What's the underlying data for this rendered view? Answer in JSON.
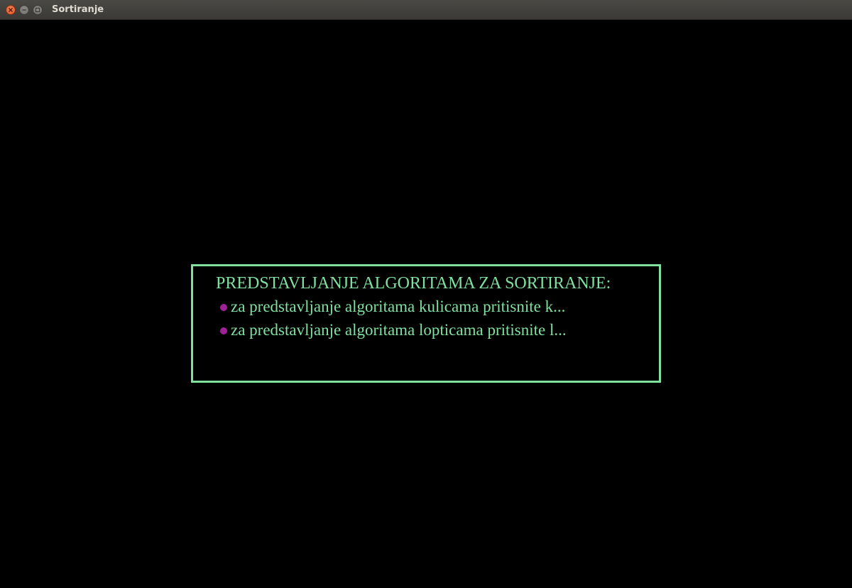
{
  "window": {
    "title": "Sortiranje"
  },
  "menu": {
    "heading": "PREDSTAVLJANJE ALGORITAMA ZA SORTIRANJE:",
    "items": [
      {
        "label": "za predstavljanje algoritama kulicama pritisnite k..."
      },
      {
        "label": "za predstavljanje algoritama lopticama pritisnite l..."
      }
    ]
  },
  "colors": {
    "background": "#000000",
    "text": "#7fe0a0",
    "border": "#7fe0a0",
    "bullet": "#a0209a",
    "close_button": "#e25523"
  },
  "icons": [
    "close-icon",
    "minimize-icon",
    "maximize-icon"
  ]
}
